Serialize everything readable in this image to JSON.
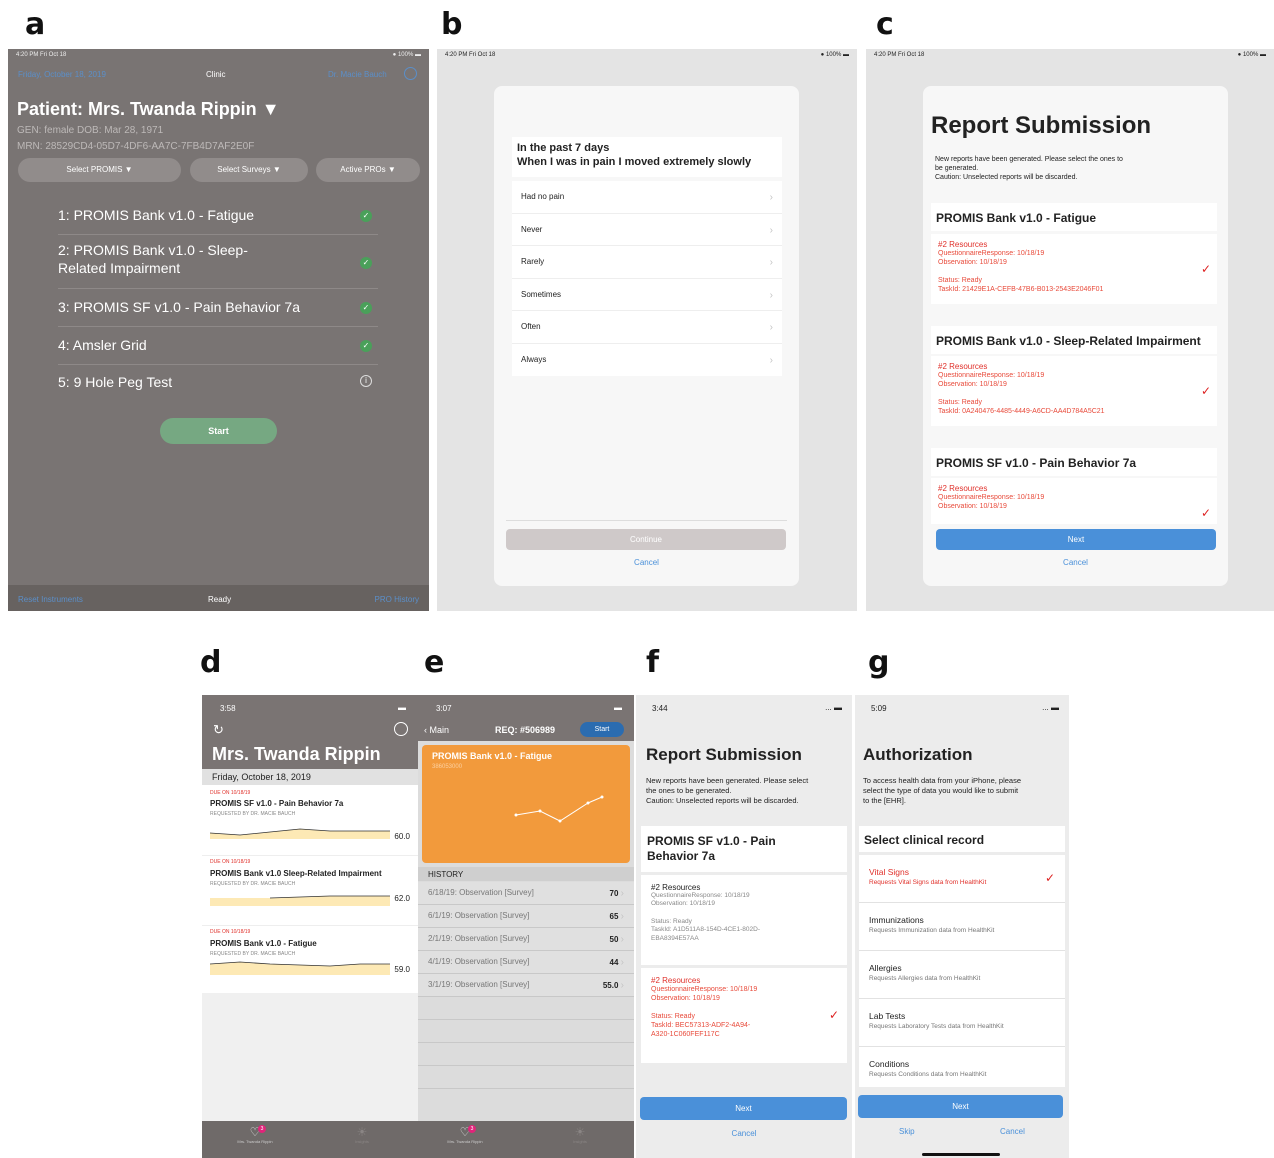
{
  "labels": {
    "a": "a",
    "b": "b",
    "c": "c",
    "d": "d",
    "e": "e",
    "f": "f",
    "g": "g"
  },
  "colors": {
    "clinic_bg": "#797473",
    "clinic_dark": "#676260",
    "ios_blue": "#4a90d9",
    "red": "#e0312b",
    "orange": "#f29a3c",
    "green": "#4aa05a"
  },
  "a": {
    "status_time": "4:20 PM  Fri Oct 18",
    "status_battery": "100%",
    "nav_date": "Friday, October 18, 2019",
    "nav_title": "Clinic",
    "nav_doctor": "Dr. Macie Bauch",
    "patient_title": "Patient: Mrs. Twanda Rippin",
    "gen_line": "GEN: female   DOB:  Mar 28, 1971",
    "mrn_line": "MRN: 28529CD4-05D7-4DF6-AA7C-7FB4D7AF2E0F",
    "select_promis": "Select PROMIS ▼",
    "select_surveys": "Select Surveys ▼",
    "active_pros": "Active PROs ▼",
    "items": [
      "1: PROMIS Bank v1.0 - Fatigue",
      "2: PROMIS Bank v1.0 - Sleep-",
      "3: PROMIS SF v1.0 - Pain Behavior 7a",
      "4: Amsler Grid",
      "5: 9 Hole Peg Test"
    ],
    "item2_line2": "Related Impairment",
    "start": "Start",
    "footer_left": "Reset Instruments",
    "footer_center": "Ready",
    "footer_right": "PRO History"
  },
  "b": {
    "status_time": "4:20 PM  Fri Oct 18",
    "status_battery": "100%",
    "question_line1": "In the past 7 days",
    "question_line2": "When I was in pain I moved extremely slowly",
    "options": [
      "Had no pain",
      "Never",
      "Rarely",
      "Sometimes",
      "Often",
      "Always"
    ],
    "continue": "Continue",
    "cancel": "Cancel"
  },
  "c": {
    "status_time": "4:20 PM  Fri Oct 18",
    "status_battery": "100%",
    "title": "Report Submission",
    "desc1": "New reports have been generated. Please select the ones to",
    "desc2": "be generated.",
    "desc3": "Caution: Unselected reports will be discarded.",
    "reports": [
      {
        "name": "PROMIS Bank v1.0 - Fatigue",
        "resources": "#2 Resources",
        "qr": "QuestionnaireResponse: 10/18/19",
        "obs": "Observation: 10/18/19",
        "status": "Status: Ready",
        "task": "TaskId: 21429E1A-CEFB-47B6-B013-2543E2046F01"
      },
      {
        "name": "PROMIS Bank v1.0 - Sleep-Related Impairment",
        "resources": "#2 Resources",
        "qr": "QuestionnaireResponse: 10/18/19",
        "obs": "Observation: 10/18/19",
        "status": "Status: Ready",
        "task": "TaskId: 0A240476-4485-4449-A6CD-AA4D784A5C21"
      },
      {
        "name": "PROMIS SF v1.0 - Pain Behavior 7a",
        "resources": "#2 Resources",
        "qr": "QuestionnaireResponse: 10/18/19",
        "obs": "Observation: 10/18/19"
      }
    ],
    "next": "Next",
    "cancel": "Cancel"
  },
  "d": {
    "status_time": "3:58",
    "title": "Mrs. Twanda Rippin",
    "date": "Friday, October 18, 2019",
    "cards": [
      {
        "due": "DUE ON 10/18/19",
        "name": "PROMIS SF v1.0 - Pain Behavior 7a",
        "req": "REQUESTED BY DR. MACIE BAUCH",
        "value": "60.0"
      },
      {
        "due": "DUE ON 10/18/19",
        "name": "PROMIS Bank v1.0 Sleep-Related Impairment",
        "req": "REQUESTED BY DR. MACIE BAUCH",
        "value": "62.0"
      },
      {
        "due": "DUE ON 10/18/19",
        "name": "PROMIS Bank v1.0 - Fatigue",
        "req": "REQUESTED BY DR. MACIE BAUCH",
        "value": "59.0"
      }
    ],
    "tab1": "Mrs. Twanda Rippin",
    "tab2": "Insights",
    "badge": "3"
  },
  "e": {
    "status_time": "3:07",
    "back": "Main",
    "req": "REQ: #506989",
    "start": "Start",
    "card_title": "PROMIS Bank v1.0 - Fatigue",
    "card_sub": "386053000",
    "history_label": "HISTORY",
    "history": [
      {
        "date": "6/18/19: Observation [Survey]",
        "value": "70"
      },
      {
        "date": "6/1/19: Observation [Survey]",
        "value": "65"
      },
      {
        "date": "2/1/19: Observation [Survey]",
        "value": "50"
      },
      {
        "date": "4/1/19: Observation [Survey]",
        "value": "44"
      },
      {
        "date": "3/1/19: Observation [Survey]",
        "value": "55.0"
      }
    ],
    "tab1": "Mrs. Twanda Rippin",
    "tab2": "Insights",
    "badge": "3"
  },
  "f": {
    "status_time": "3:44",
    "title": "Report Submission",
    "desc1": "New reports have been generated. Please select",
    "desc2": "the ones to be generated.",
    "desc3": "Caution: Unselected reports will be discarded.",
    "report_name1": "PROMIS SF v1.0 - Pain",
    "report_name2": "Behavior 7a",
    "r1": {
      "resources": "#2 Resources",
      "qr": "QuestionnaireResponse: 10/18/19",
      "obs": "Observation: 10/18/19",
      "status": "Status: Ready",
      "task1": "TaskId: A1D511A8-154D-4CE1-802D-",
      "task2": "EBA8394E57AA"
    },
    "r2": {
      "resources": "#2 Resources",
      "qr": "QuestionnaireResponse: 10/18/19",
      "obs": "Observation: 10/18/19",
      "status": "Status: Ready",
      "task1": "TaskId: BEC57313-ADF2-4A94-",
      "task2": "A320-1C060FEF117C"
    },
    "next": "Next",
    "cancel": "Cancel"
  },
  "g": {
    "status_time": "5:09",
    "title": "Authorization",
    "desc1": "To access health data from your iPhone, please",
    "desc2": "select the type of data you would like to submit",
    "desc3": "to the [EHR].",
    "section": "Select clinical record",
    "records": [
      {
        "name": "Vital Signs",
        "sub": "Requests Vital Signs data from HealthKit"
      },
      {
        "name": "Immunizations",
        "sub": "Requests Immunization data from HealthKit"
      },
      {
        "name": "Allergies",
        "sub": "Requests Allergies data from HealthKit"
      },
      {
        "name": "Lab Tests",
        "sub": "Requests Laboratory Tests data from HealthKit"
      },
      {
        "name": "Conditions",
        "sub": "Requests Conditions data from HealthKit"
      }
    ],
    "next": "Next",
    "skip": "Skip",
    "cancel": "Cancel"
  }
}
